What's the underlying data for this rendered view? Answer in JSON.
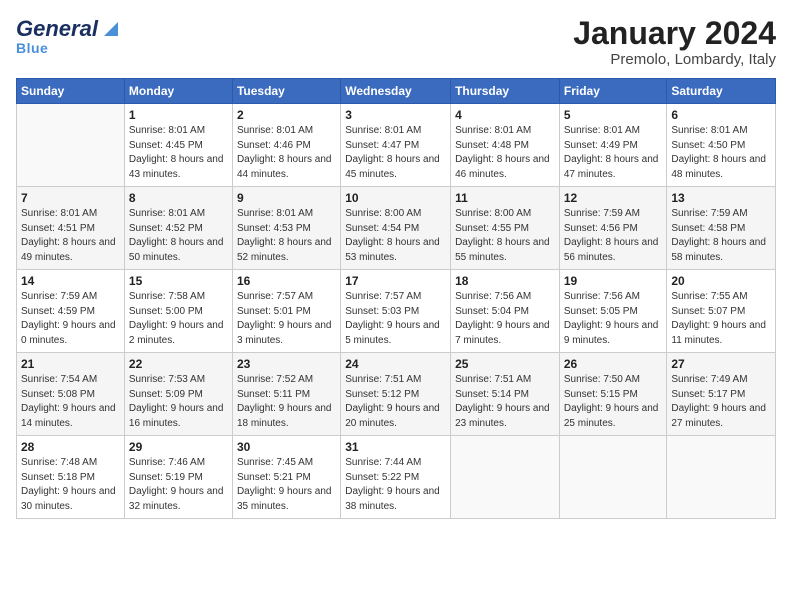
{
  "header": {
    "logo_general": "General",
    "logo_blue": "Blue",
    "month_title": "January 2024",
    "location": "Premolo, Lombardy, Italy"
  },
  "days_of_week": [
    "Sunday",
    "Monday",
    "Tuesday",
    "Wednesday",
    "Thursday",
    "Friday",
    "Saturday"
  ],
  "weeks": [
    [
      {
        "day": "",
        "sunrise": "",
        "sunset": "",
        "daylight": ""
      },
      {
        "day": "1",
        "sunrise": "Sunrise: 8:01 AM",
        "sunset": "Sunset: 4:45 PM",
        "daylight": "Daylight: 8 hours and 43 minutes."
      },
      {
        "day": "2",
        "sunrise": "Sunrise: 8:01 AM",
        "sunset": "Sunset: 4:46 PM",
        "daylight": "Daylight: 8 hours and 44 minutes."
      },
      {
        "day": "3",
        "sunrise": "Sunrise: 8:01 AM",
        "sunset": "Sunset: 4:47 PM",
        "daylight": "Daylight: 8 hours and 45 minutes."
      },
      {
        "day": "4",
        "sunrise": "Sunrise: 8:01 AM",
        "sunset": "Sunset: 4:48 PM",
        "daylight": "Daylight: 8 hours and 46 minutes."
      },
      {
        "day": "5",
        "sunrise": "Sunrise: 8:01 AM",
        "sunset": "Sunset: 4:49 PM",
        "daylight": "Daylight: 8 hours and 47 minutes."
      },
      {
        "day": "6",
        "sunrise": "Sunrise: 8:01 AM",
        "sunset": "Sunset: 4:50 PM",
        "daylight": "Daylight: 8 hours and 48 minutes."
      }
    ],
    [
      {
        "day": "7",
        "sunrise": "Sunrise: 8:01 AM",
        "sunset": "Sunset: 4:51 PM",
        "daylight": "Daylight: 8 hours and 49 minutes."
      },
      {
        "day": "8",
        "sunrise": "Sunrise: 8:01 AM",
        "sunset": "Sunset: 4:52 PM",
        "daylight": "Daylight: 8 hours and 50 minutes."
      },
      {
        "day": "9",
        "sunrise": "Sunrise: 8:01 AM",
        "sunset": "Sunset: 4:53 PM",
        "daylight": "Daylight: 8 hours and 52 minutes."
      },
      {
        "day": "10",
        "sunrise": "Sunrise: 8:00 AM",
        "sunset": "Sunset: 4:54 PM",
        "daylight": "Daylight: 8 hours and 53 minutes."
      },
      {
        "day": "11",
        "sunrise": "Sunrise: 8:00 AM",
        "sunset": "Sunset: 4:55 PM",
        "daylight": "Daylight: 8 hours and 55 minutes."
      },
      {
        "day": "12",
        "sunrise": "Sunrise: 7:59 AM",
        "sunset": "Sunset: 4:56 PM",
        "daylight": "Daylight: 8 hours and 56 minutes."
      },
      {
        "day": "13",
        "sunrise": "Sunrise: 7:59 AM",
        "sunset": "Sunset: 4:58 PM",
        "daylight": "Daylight: 8 hours and 58 minutes."
      }
    ],
    [
      {
        "day": "14",
        "sunrise": "Sunrise: 7:59 AM",
        "sunset": "Sunset: 4:59 PM",
        "daylight": "Daylight: 9 hours and 0 minutes."
      },
      {
        "day": "15",
        "sunrise": "Sunrise: 7:58 AM",
        "sunset": "Sunset: 5:00 PM",
        "daylight": "Daylight: 9 hours and 2 minutes."
      },
      {
        "day": "16",
        "sunrise": "Sunrise: 7:57 AM",
        "sunset": "Sunset: 5:01 PM",
        "daylight": "Daylight: 9 hours and 3 minutes."
      },
      {
        "day": "17",
        "sunrise": "Sunrise: 7:57 AM",
        "sunset": "Sunset: 5:03 PM",
        "daylight": "Daylight: 9 hours and 5 minutes."
      },
      {
        "day": "18",
        "sunrise": "Sunrise: 7:56 AM",
        "sunset": "Sunset: 5:04 PM",
        "daylight": "Daylight: 9 hours and 7 minutes."
      },
      {
        "day": "19",
        "sunrise": "Sunrise: 7:56 AM",
        "sunset": "Sunset: 5:05 PM",
        "daylight": "Daylight: 9 hours and 9 minutes."
      },
      {
        "day": "20",
        "sunrise": "Sunrise: 7:55 AM",
        "sunset": "Sunset: 5:07 PM",
        "daylight": "Daylight: 9 hours and 11 minutes."
      }
    ],
    [
      {
        "day": "21",
        "sunrise": "Sunrise: 7:54 AM",
        "sunset": "Sunset: 5:08 PM",
        "daylight": "Daylight: 9 hours and 14 minutes."
      },
      {
        "day": "22",
        "sunrise": "Sunrise: 7:53 AM",
        "sunset": "Sunset: 5:09 PM",
        "daylight": "Daylight: 9 hours and 16 minutes."
      },
      {
        "day": "23",
        "sunrise": "Sunrise: 7:52 AM",
        "sunset": "Sunset: 5:11 PM",
        "daylight": "Daylight: 9 hours and 18 minutes."
      },
      {
        "day": "24",
        "sunrise": "Sunrise: 7:51 AM",
        "sunset": "Sunset: 5:12 PM",
        "daylight": "Daylight: 9 hours and 20 minutes."
      },
      {
        "day": "25",
        "sunrise": "Sunrise: 7:51 AM",
        "sunset": "Sunset: 5:14 PM",
        "daylight": "Daylight: 9 hours and 23 minutes."
      },
      {
        "day": "26",
        "sunrise": "Sunrise: 7:50 AM",
        "sunset": "Sunset: 5:15 PM",
        "daylight": "Daylight: 9 hours and 25 minutes."
      },
      {
        "day": "27",
        "sunrise": "Sunrise: 7:49 AM",
        "sunset": "Sunset: 5:17 PM",
        "daylight": "Daylight: 9 hours and 27 minutes."
      }
    ],
    [
      {
        "day": "28",
        "sunrise": "Sunrise: 7:48 AM",
        "sunset": "Sunset: 5:18 PM",
        "daylight": "Daylight: 9 hours and 30 minutes."
      },
      {
        "day": "29",
        "sunrise": "Sunrise: 7:46 AM",
        "sunset": "Sunset: 5:19 PM",
        "daylight": "Daylight: 9 hours and 32 minutes."
      },
      {
        "day": "30",
        "sunrise": "Sunrise: 7:45 AM",
        "sunset": "Sunset: 5:21 PM",
        "daylight": "Daylight: 9 hours and 35 minutes."
      },
      {
        "day": "31",
        "sunrise": "Sunrise: 7:44 AM",
        "sunset": "Sunset: 5:22 PM",
        "daylight": "Daylight: 9 hours and 38 minutes."
      },
      {
        "day": "",
        "sunrise": "",
        "sunset": "",
        "daylight": ""
      },
      {
        "day": "",
        "sunrise": "",
        "sunset": "",
        "daylight": ""
      },
      {
        "day": "",
        "sunrise": "",
        "sunset": "",
        "daylight": ""
      }
    ]
  ]
}
